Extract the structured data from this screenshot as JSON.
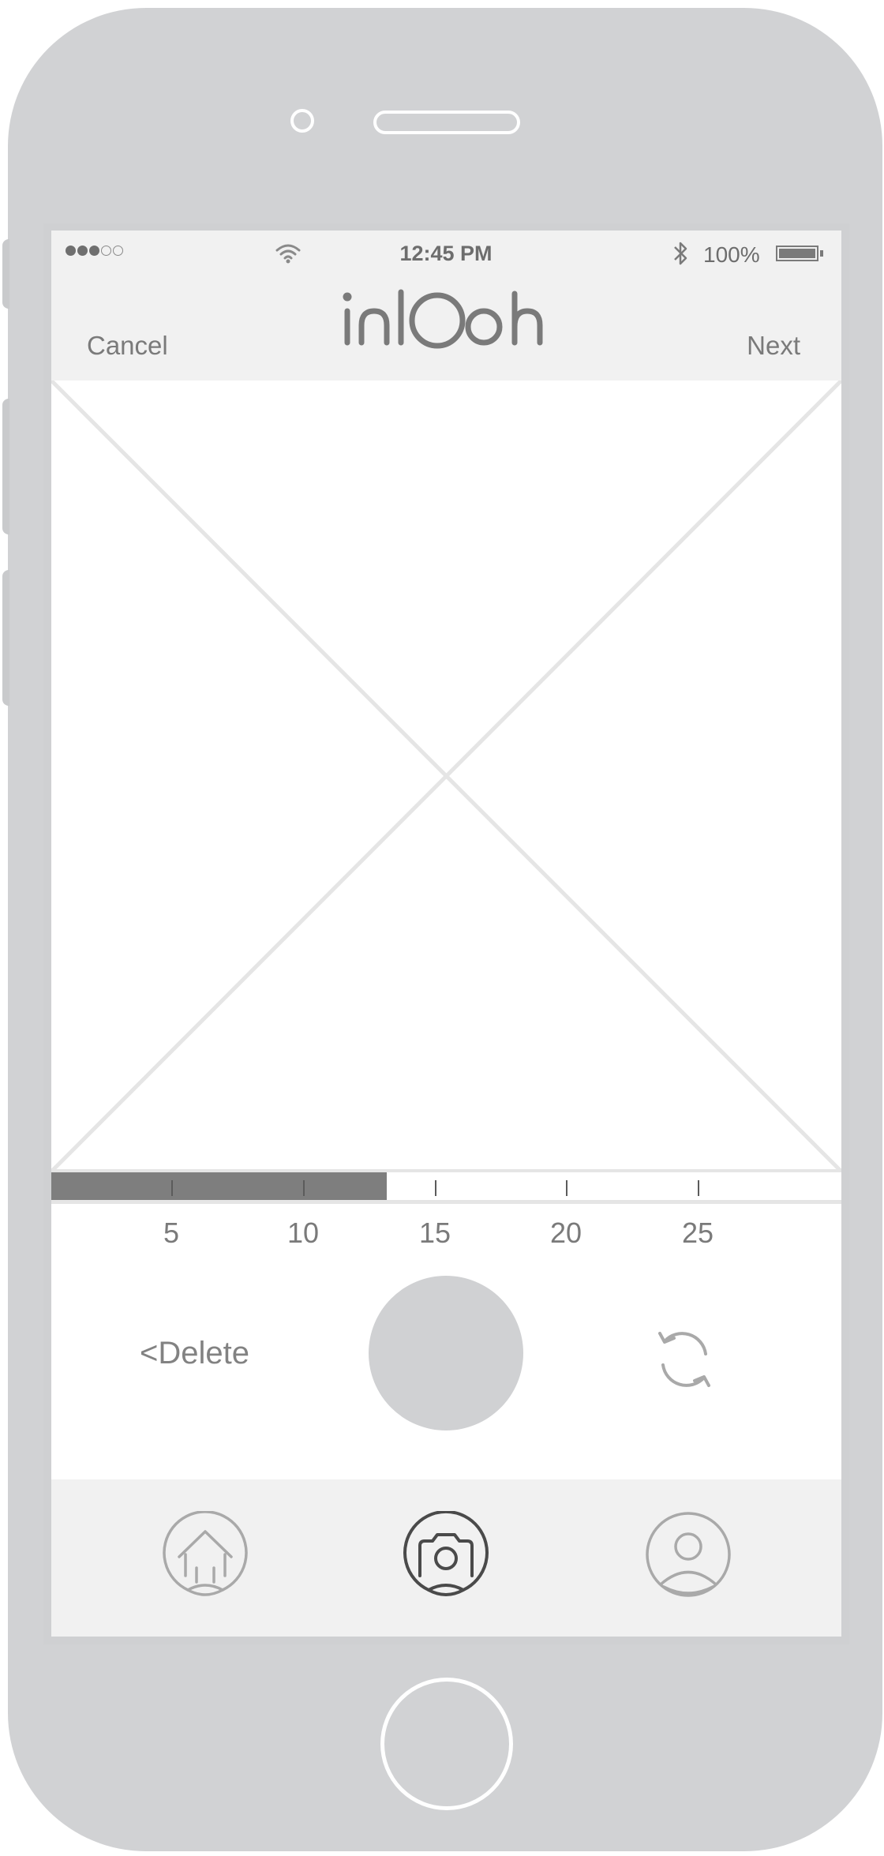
{
  "status_bar": {
    "time": "12:45 PM",
    "battery_percent": "100%",
    "signal_bars_filled": 3,
    "signal_bars_total": 5,
    "icons": [
      "signal-dots-icon",
      "wifi-icon",
      "bluetooth-icon",
      "battery-icon"
    ]
  },
  "header": {
    "logo_text": "inlooh",
    "cancel_label": "Cancel",
    "next_label": "Next"
  },
  "media": {
    "placeholder_icon": "image-placeholder-icon"
  },
  "timeline": {
    "ticks": [
      "5",
      "10",
      "15",
      "20",
      "25"
    ],
    "max_seconds": 30,
    "progress": 0.425
  },
  "controls": {
    "delete_label": "<Delete",
    "shutter_icon": "record-button",
    "flip_icon": "switch-camera-icon"
  },
  "tabbar": {
    "items": [
      {
        "icon": "home-icon",
        "active": false
      },
      {
        "icon": "camera-icon",
        "active": true
      },
      {
        "icon": "profile-icon",
        "active": false
      }
    ]
  },
  "colors": {
    "device": "#d1d2d4",
    "header_bg": "#f1f1f1",
    "text_gray": "#7a7a7a",
    "progress_fill": "#7e7e7e",
    "active_icon": "#4a4a4a",
    "inactive_icon": "#a9a9a9"
  }
}
